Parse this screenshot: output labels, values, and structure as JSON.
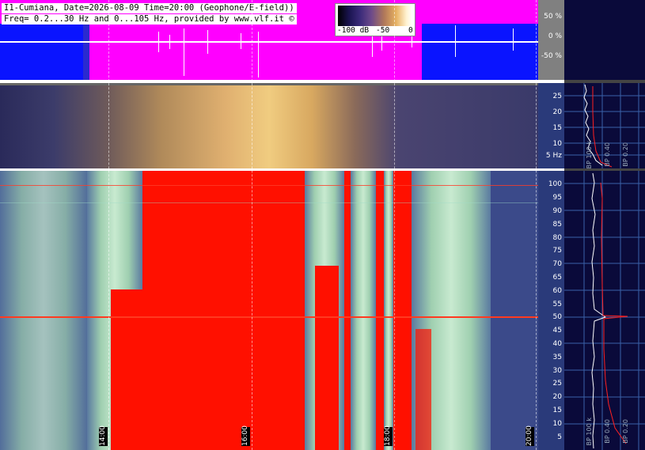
{
  "station_caption": "I1-Cumiana, Date=2026-08-09 Time=20:00 (Geophone/E-field))",
  "freq_caption": "Freq= 0.2...30 Hz and 0...105 Hz, provided by www.vlf.it ©",
  "colorbar": {
    "min_label": "-100 dB",
    "mid_label": "-50",
    "max_label": "0"
  },
  "amplitude_scale": [
    "50 %",
    "0 %",
    "-50 %"
  ],
  "band1_ticks": [
    "25",
    "20",
    "15",
    "10",
    "5 Hz"
  ],
  "band2_ticks": [
    "100",
    "95",
    "90",
    "85",
    "80",
    "75",
    "70",
    "65",
    "60",
    "55",
    "50",
    "45",
    "40",
    "35",
    "30",
    "25",
    "20",
    "15",
    "10",
    "5"
  ],
  "time_labels": [
    "14:00",
    "16:00",
    "18:00",
    "20:00"
  ],
  "bp_labels_top": [
    "BP 100 k",
    "BP 0.40",
    "BP 0.20"
  ],
  "bp_labels_bottom": [
    "BP 100 k",
    "BP 0.40",
    "BP 0.20"
  ],
  "colors": {
    "wave_bg": "#ff00ff",
    "wave_blue": "#0a14ff",
    "saturated": "#ff1000",
    "panel": "#0a0a3a"
  }
}
